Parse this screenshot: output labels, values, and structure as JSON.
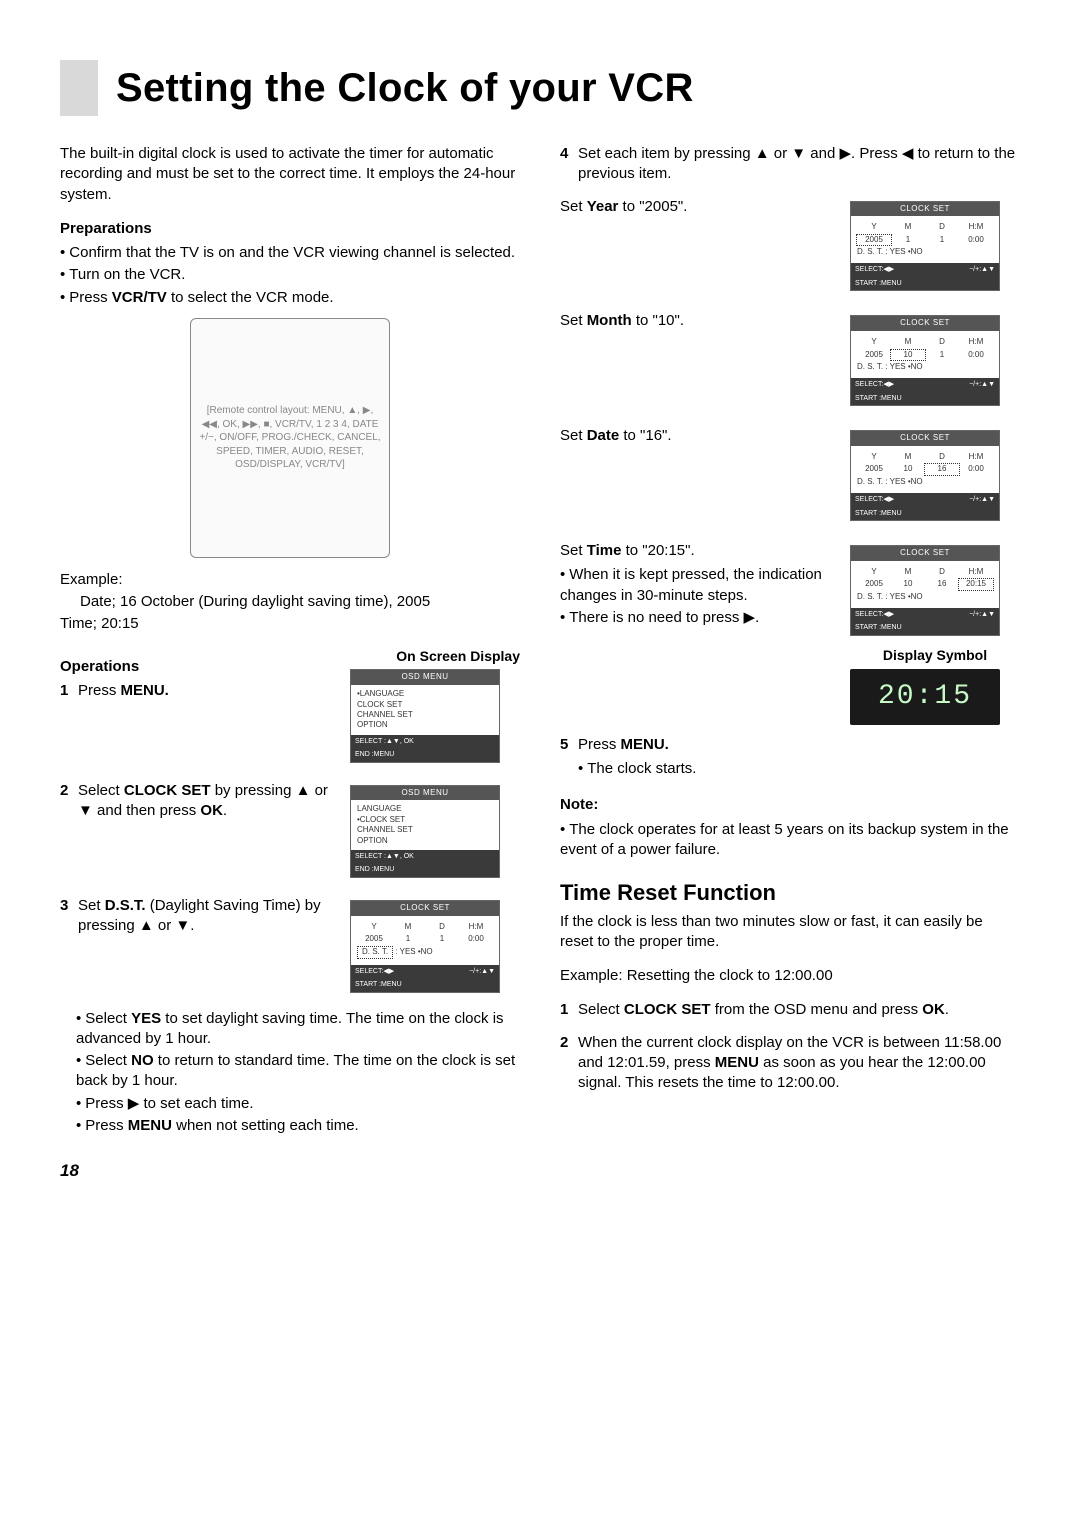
{
  "title": "Setting the Clock of your VCR",
  "intro": "The built-in digital clock is used to activate the timer for automatic recording and must be set to the correct time. It employs the 24-hour system.",
  "preparations": {
    "heading": "Preparations",
    "items": [
      "Confirm that the TV is on and the VCR viewing channel is selected.",
      "Turn on the VCR.",
      "Press VCR/TV to select the VCR mode."
    ]
  },
  "remote_placeholder": "[Remote control layout: MENU, ▲, ▶, ◀◀, OK, ▶▶, ■, VCR/TV, 1 2 3 4, DATE +/−, ON/OFF, PROG./CHECK, CANCEL, SPEED, TIMER, AUDIO, RESET, OSD/DISPLAY, VCR/TV]",
  "example": {
    "label": "Example:",
    "line1": "Date;  16 October (During daylight saving time), 2005",
    "line2": "Time;  20:15"
  },
  "operations_heading": "Operations",
  "osd_label": "On Screen Display",
  "osd_menu": {
    "title": "OSD MENU",
    "items": [
      "•LANGUAGE",
      " CLOCK SET",
      " CHANNEL SET",
      " OPTION"
    ],
    "footer_l": "SELECT  :▲▼, OK",
    "footer_l2": "END       :MENU"
  },
  "osd_menu2": {
    "title": "OSD MENU",
    "items": [
      " LANGUAGE",
      "•CLOCK SET",
      " CHANNEL SET",
      " OPTION"
    ]
  },
  "clock_set_base": {
    "title": "CLOCK SET",
    "headers": [
      "Y",
      "M",
      "D",
      "H:M"
    ],
    "dst_label": "D. S. T.     : YES   •NO",
    "footer_l": "SELECT:◀▶",
    "footer_r": "−/+:▲▼",
    "footer_l2": "START   :MENU"
  },
  "clocks": {
    "dst": {
      "cells": [
        "2005",
        "1",
        "1",
        "0:00"
      ],
      "sel": "dst"
    },
    "year": {
      "cells": [
        "2005",
        "1",
        "1",
        "0:00"
      ],
      "sel": 0
    },
    "month": {
      "cells": [
        "2005",
        "10",
        "1",
        "0:00"
      ],
      "sel": 1
    },
    "date": {
      "cells": [
        "2005",
        "10",
        "16",
        "0:00"
      ],
      "sel": 2
    },
    "time": {
      "cells": [
        "2005",
        "10",
        "16",
        "20:15"
      ],
      "sel": 3
    }
  },
  "ops": [
    {
      "n": "1",
      "text": "Press MENU."
    },
    {
      "n": "2",
      "text": "Select CLOCK SET by pressing ▲ or ▼ and then press OK."
    },
    {
      "n": "3",
      "text": "Set D.S.T. (Daylight Saving Time) by pressing ▲ or ▼."
    }
  ],
  "dst_notes": [
    "Select YES to set daylight saving time. The time on the clock is advanced by 1 hour.",
    "Select NO to return to standard time. The time on the clock is set back by 1 hour.",
    "Press ▶ to set each time.",
    "Press MENU when not setting each time."
  ],
  "step4_intro": "Set each item by pressing ▲ or ▼ and ▶. Press ◀ to return to the previous item.",
  "step4_num": "4",
  "set_year": "Set Year to \"2005\".",
  "set_month": "Set Month to \"10\".",
  "set_date": "Set Date to \"16\".",
  "set_time": "Set Time to \"20:15\".",
  "time_bullets": [
    "When it is kept pressed, the indication changes in 30-minute steps.",
    "There is no need to press ▶."
  ],
  "display_symbol_label": "Display Symbol",
  "display_symbol_value": "20:15",
  "step5_num": "5",
  "step5_text": "Press MENU.",
  "step5_bullets": [
    "The clock starts."
  ],
  "note_heading": "Note:",
  "note_bullets": [
    "The clock operates for at least 5 years on its backup system in the event of a power failure."
  ],
  "reset": {
    "heading": "Time Reset Function",
    "intro": "If the clock is less than two minutes slow or fast, it can easily be reset to the proper time.",
    "example": "Example:  Resetting the clock to 12:00.00",
    "steps": [
      {
        "n": "1",
        "text": "Select CLOCK SET from the OSD menu and press OK."
      },
      {
        "n": "2",
        "text": "When the current clock display on the VCR is between 11:58.00 and 12:01.59, press MENU as soon as you hear the 12:00.00 signal. This resets the time to 12:00.00."
      }
    ]
  },
  "page_number": "18"
}
